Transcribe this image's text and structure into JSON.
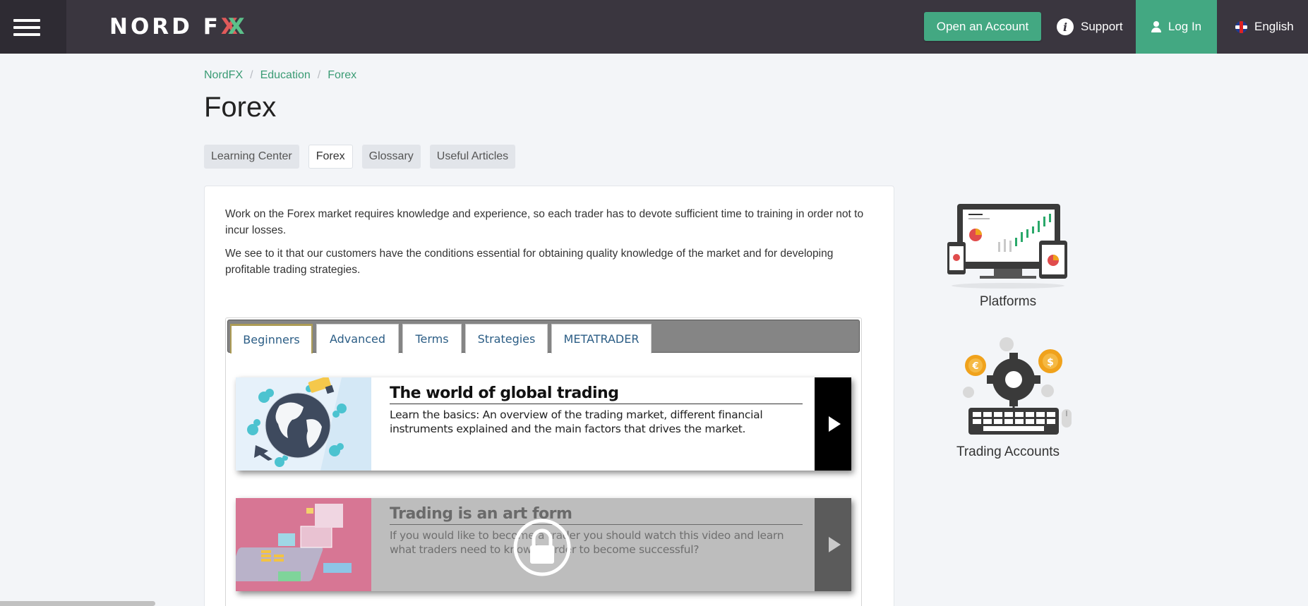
{
  "header": {
    "logo_main": "NORD F",
    "logo_x": "X",
    "open_account": "Open an Account",
    "support": "Support",
    "login": "Log In",
    "language": "English",
    "colors": {
      "bar": "#3a363f",
      "accent": "#43a882"
    }
  },
  "breadcrumb": [
    "NordFX",
    "Education",
    "Forex"
  ],
  "page_title": "Forex",
  "subtabs": [
    "Learning Center",
    "Forex",
    "Glossary",
    "Useful Articles"
  ],
  "intro": [
    "Work on the Forex market requires knowledge and experience, so each trader has to devote sufficient time to training in order not to incur losses.",
    "We see to it that our customers have the conditions essential for obtaining quality knowledge of the market and for developing profitable trading strategies."
  ],
  "course_tabs": [
    "Beginners",
    "Advanced",
    "Terms",
    "Strategies",
    "METATRADER"
  ],
  "lessons": [
    {
      "title": "The world of global trading",
      "description": "Learn the basics: An overview of the trading market, different financial instruments explained and the main factors that drives the market.",
      "locked": false
    },
    {
      "title": "Trading is an art form",
      "description": "If you would like to become a trader you should watch this video and learn what traders need to know in order to become successful?",
      "locked": true
    }
  ],
  "sidebar": {
    "platforms": "Platforms",
    "trading_accounts": "Trading Accounts"
  },
  "icons": [
    "menu-icon",
    "info-icon",
    "user-icon",
    "uk-flag-icon",
    "play-icon",
    "lock-icon",
    "platforms-illustration",
    "trading-accounts-illustration"
  ]
}
